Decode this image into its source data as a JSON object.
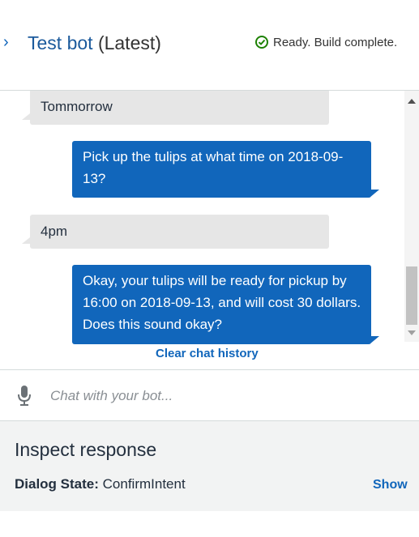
{
  "header": {
    "bot_name": "Test bot",
    "version": "(Latest)",
    "status": "Ready. Build complete."
  },
  "messages": [
    {
      "role": "bot",
      "text": "Tommorrow"
    },
    {
      "role": "user",
      "text": "Pick up the tulips at what time on 2018-09-13?"
    },
    {
      "role": "bot",
      "text": "4pm"
    },
    {
      "role": "user",
      "text": "Okay, your tulips will be ready for pickup by 16:00 on 2018-09-13, and will cost 30 dollars. Does this sound okay?"
    }
  ],
  "chat": {
    "clear_label": "Clear chat history",
    "input_placeholder": "Chat with your bot..."
  },
  "inspect": {
    "title": "Inspect response",
    "dialog_state_label": "Dialog State:",
    "dialog_state_value": "ConfirmIntent",
    "show_label": "Show"
  },
  "colors": {
    "accent": "#1166bb",
    "success": "#1d8102",
    "bot_bubble": "#e6e6e6"
  },
  "icons": [
    "chevron-right-icon",
    "check-circle-icon",
    "microphone-icon"
  ]
}
